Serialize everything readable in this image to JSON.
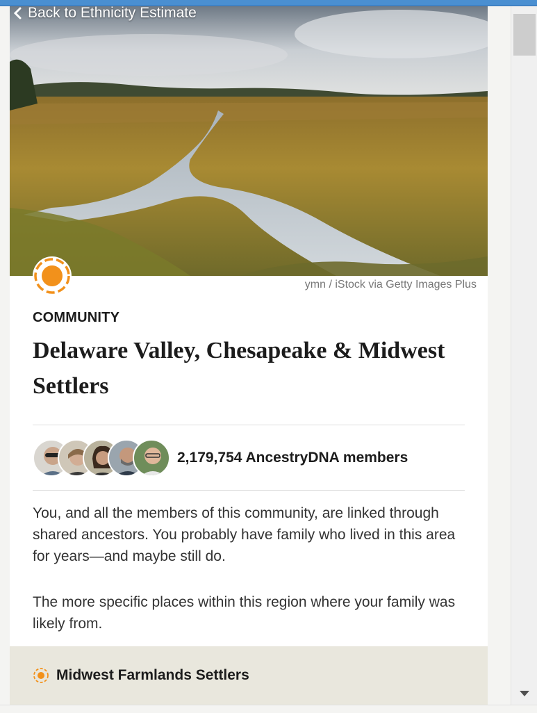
{
  "back_link": {
    "label": "Back to Ethnicity Estimate"
  },
  "hero": {
    "credit": "ymn / iStock via Getty Images Plus"
  },
  "community": {
    "eyebrow": "COMMUNITY",
    "title": "Delaware Valley, Chesapeake & Midwest Settlers",
    "members_count": "2,179,754 AncestryDNA members",
    "description_1": "You, and all the members of this community, are linked through shared ancestors. You probably have family who lived in this area for years—and maybe still do.",
    "description_2": "The more specific places within this region where your family was likely from."
  },
  "regions": [
    {
      "label": "Midwest Farmlands Settlers"
    }
  ],
  "colors": {
    "accent_orange": "#f2911b",
    "region_row_bg": "#e9e7dd",
    "window_bar": "#4a8fd1"
  }
}
